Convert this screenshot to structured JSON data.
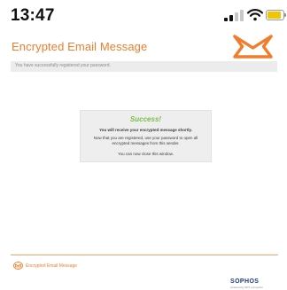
{
  "status_bar": {
    "time": "13:47",
    "icons": [
      "signal-icon",
      "wifi-icon",
      "battery-icon"
    ],
    "battery_color": "#f5c400"
  },
  "header": {
    "title": "Encrypted Email Message",
    "logo_icon": "envelope-logo-icon",
    "accent_color": "#f07d2b"
  },
  "info_bar": {
    "text": "You have successfully registered your password."
  },
  "success_box": {
    "heading": "Success!",
    "line1": "You will receive your encrypted message shortly.",
    "line2": "Now that you are registered, use your password to open all encrypted messages from this sender.",
    "line3": "You can now close this window.",
    "heading_color": "#7bbd44"
  },
  "footer": {
    "label": "Encrypted Email Message",
    "logo_icon": "envelope-logo-icon",
    "vendor": "SOPHOS",
    "vendor_tagline": "powered by SPX encryption",
    "vendor_color": "#1b3b7a"
  }
}
